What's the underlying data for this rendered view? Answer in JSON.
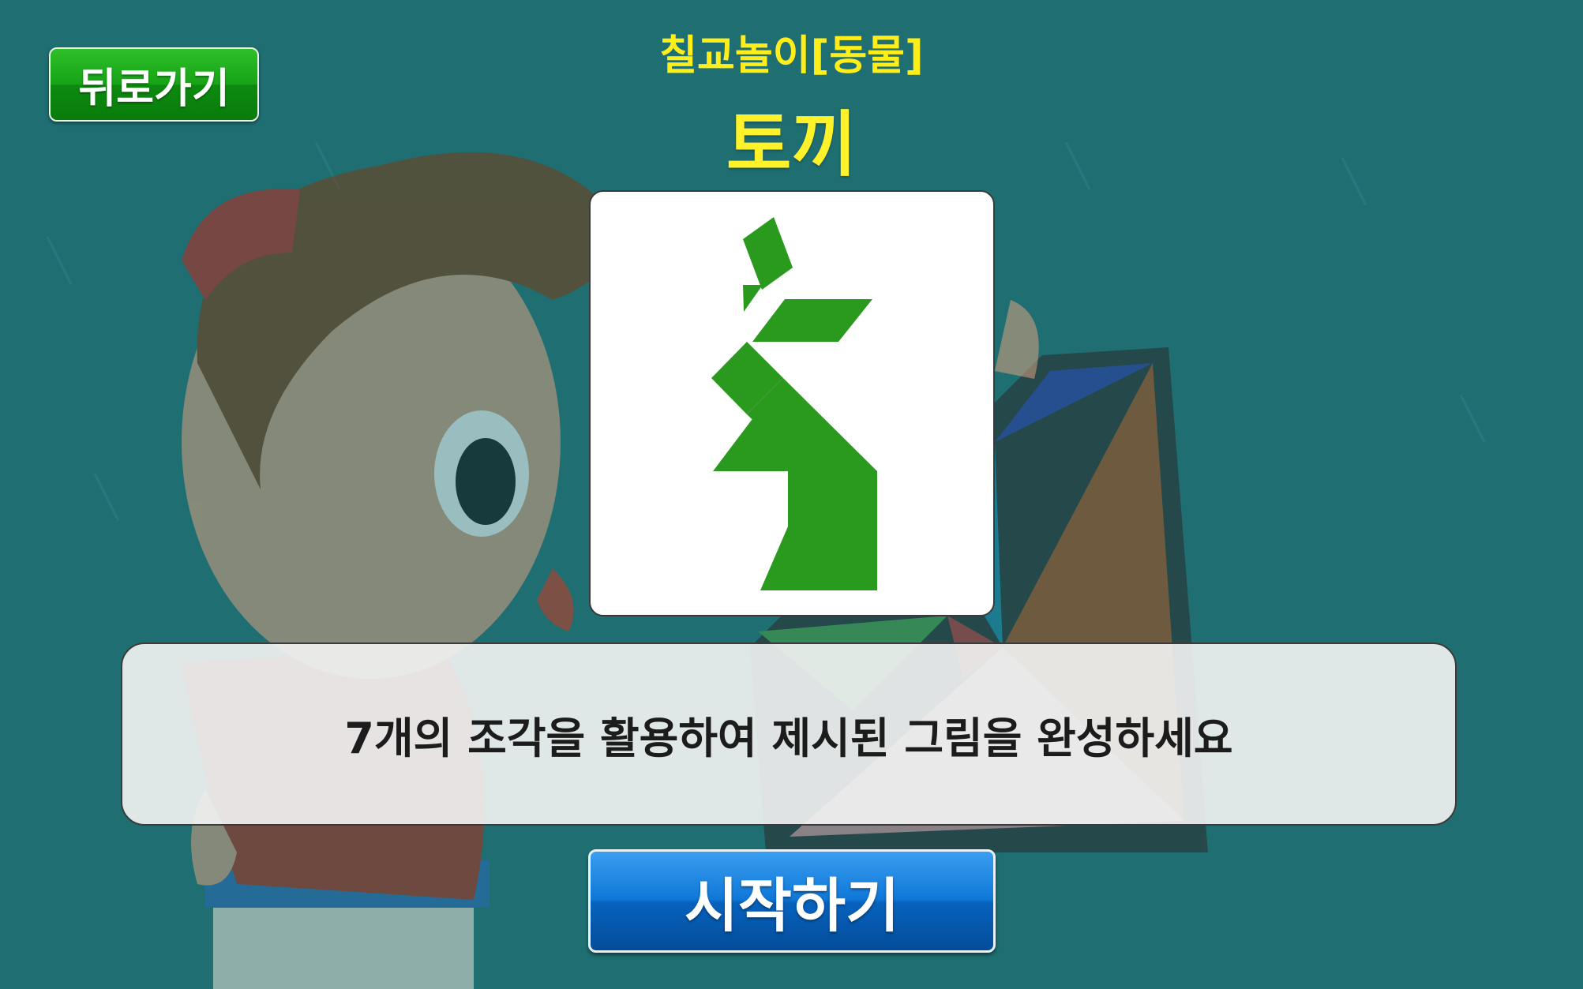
{
  "header": {
    "back_label": "뒤로가기",
    "category": "칠교놀이[동물]",
    "title": "토끼"
  },
  "puzzle": {
    "icon": "tangram-rabbit-icon",
    "piece_color": "#2a9a1e"
  },
  "instruction": {
    "text": "7개의 조각을 활용하여 제시된 그림을 완성하세요"
  },
  "actions": {
    "start_label": "시작하기"
  },
  "colors": {
    "background": "#1f6f72",
    "title_yellow": "#ffee1a",
    "back_green": "#16a316",
    "start_blue": "#0f78d8"
  }
}
